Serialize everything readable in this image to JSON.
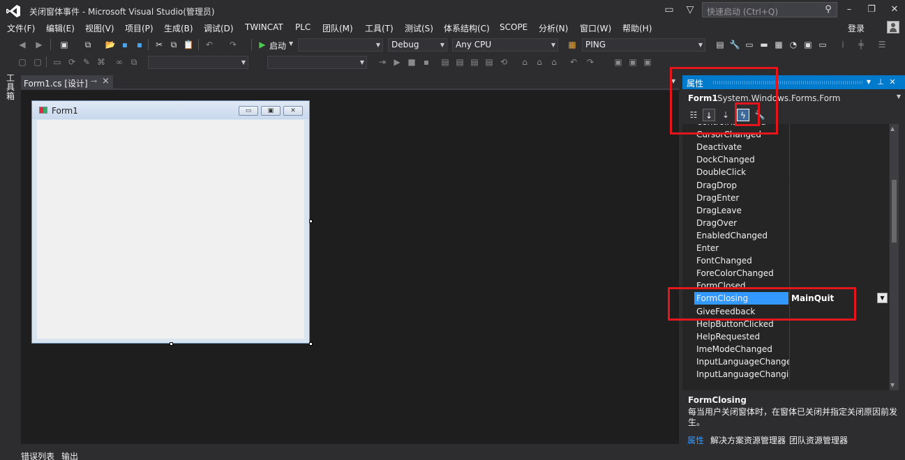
{
  "window": {
    "title": "关闭窗体事件 - Microsoft Visual Studio(管理员)",
    "quick_launch_placeholder": "快速启动 (Ctrl+Q)"
  },
  "menu": [
    "文件(F)",
    "编辑(E)",
    "视图(V)",
    "项目(P)",
    "生成(B)",
    "调试(D)",
    "TWINCAT",
    "PLC",
    "团队(M)",
    "工具(T)",
    "测试(S)",
    "体系结构(C)",
    "SCOPE",
    "分析(N)",
    "窗口(W)",
    "帮助(H)"
  ],
  "login_label": "登录",
  "toolbar": {
    "start_label": "启动",
    "config_value": "Debug",
    "platform_value": "Any CPU",
    "target_value": "PING"
  },
  "toolbox_label": "工具箱",
  "document_tab": {
    "label": "Form1.cs [设计]"
  },
  "form": {
    "title": "Form1"
  },
  "properties": {
    "header_title": "属性",
    "object_name": "Form1",
    "object_type": "System.Windows.Forms.Form",
    "events": [
      {
        "name": "ControlRemoved",
        "value": ""
      },
      {
        "name": "CursorChanged",
        "value": ""
      },
      {
        "name": "Deactivate",
        "value": ""
      },
      {
        "name": "DockChanged",
        "value": ""
      },
      {
        "name": "DoubleClick",
        "value": ""
      },
      {
        "name": "DragDrop",
        "value": ""
      },
      {
        "name": "DragEnter",
        "value": ""
      },
      {
        "name": "DragLeave",
        "value": ""
      },
      {
        "name": "DragOver",
        "value": ""
      },
      {
        "name": "EnabledChanged",
        "value": ""
      },
      {
        "name": "Enter",
        "value": ""
      },
      {
        "name": "FontChanged",
        "value": ""
      },
      {
        "name": "ForeColorChanged",
        "value": ""
      },
      {
        "name": "FormClosed",
        "value": ""
      },
      {
        "name": "FormClosing",
        "value": "MainQuit",
        "selected": true
      },
      {
        "name": "GiveFeedback",
        "value": ""
      },
      {
        "name": "HelpButtonClicked",
        "value": ""
      },
      {
        "name": "HelpRequested",
        "value": ""
      },
      {
        "name": "ImeModeChanged",
        "value": ""
      },
      {
        "name": "InputLanguageChanged",
        "value": ""
      },
      {
        "name": "InputLanguageChanging",
        "value": ""
      }
    ],
    "description_title": "FormClosing",
    "description_text": "每当用户关闭窗体时，在窗体已关闭并指定关闭原因前发生。"
  },
  "panel_tabs": [
    "属性",
    "解决方案资源管理器",
    "团队资源管理器"
  ],
  "bottom_tabs": [
    "错误列表",
    "输出"
  ],
  "colors": {
    "accent": "#007acc",
    "selection": "#3399ff",
    "annotation": "#e4161c"
  }
}
